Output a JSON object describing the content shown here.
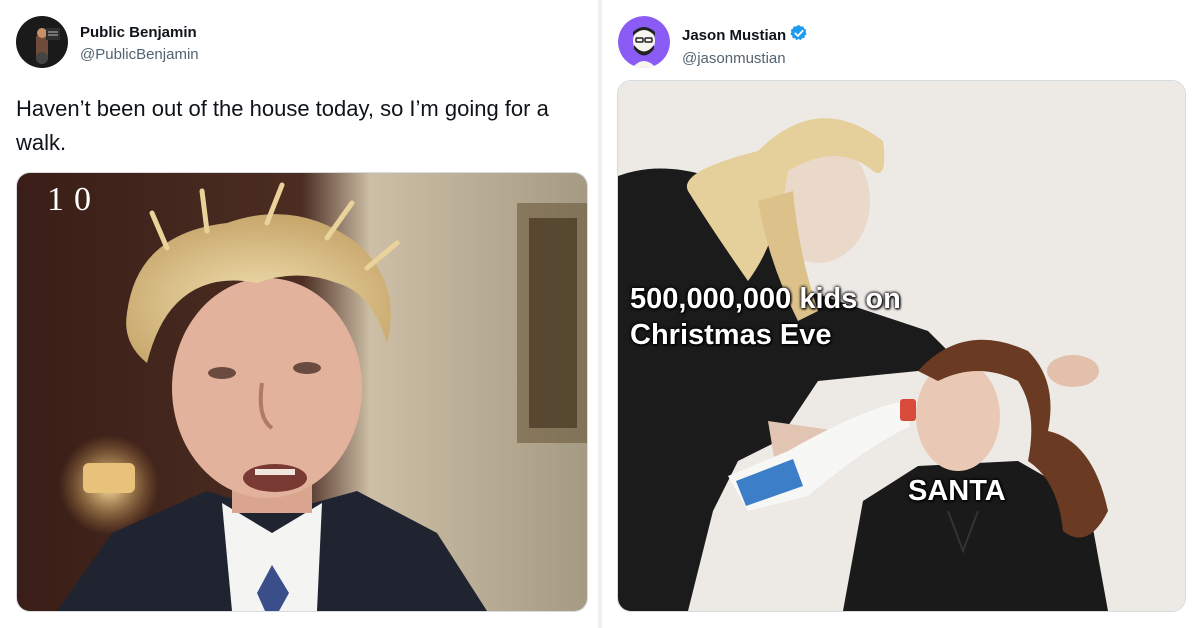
{
  "left_tweet": {
    "author_name": "Public Benjamin",
    "author_handle": "@PublicBenjamin",
    "text": "Haven’t been out of the house today, so I’m going for a walk.",
    "media_overlay": "10"
  },
  "right_tweet": {
    "author_name": "Jason Mustian",
    "author_handle": "@jasonmustian",
    "verified": true,
    "media_caption_top": "500,000,000 kids on Christmas Eve",
    "media_caption_bottom": "SANTA"
  },
  "colors": {
    "verified_badge": "#1d9bf0",
    "handle": "#536471",
    "name": "#0f1419"
  }
}
